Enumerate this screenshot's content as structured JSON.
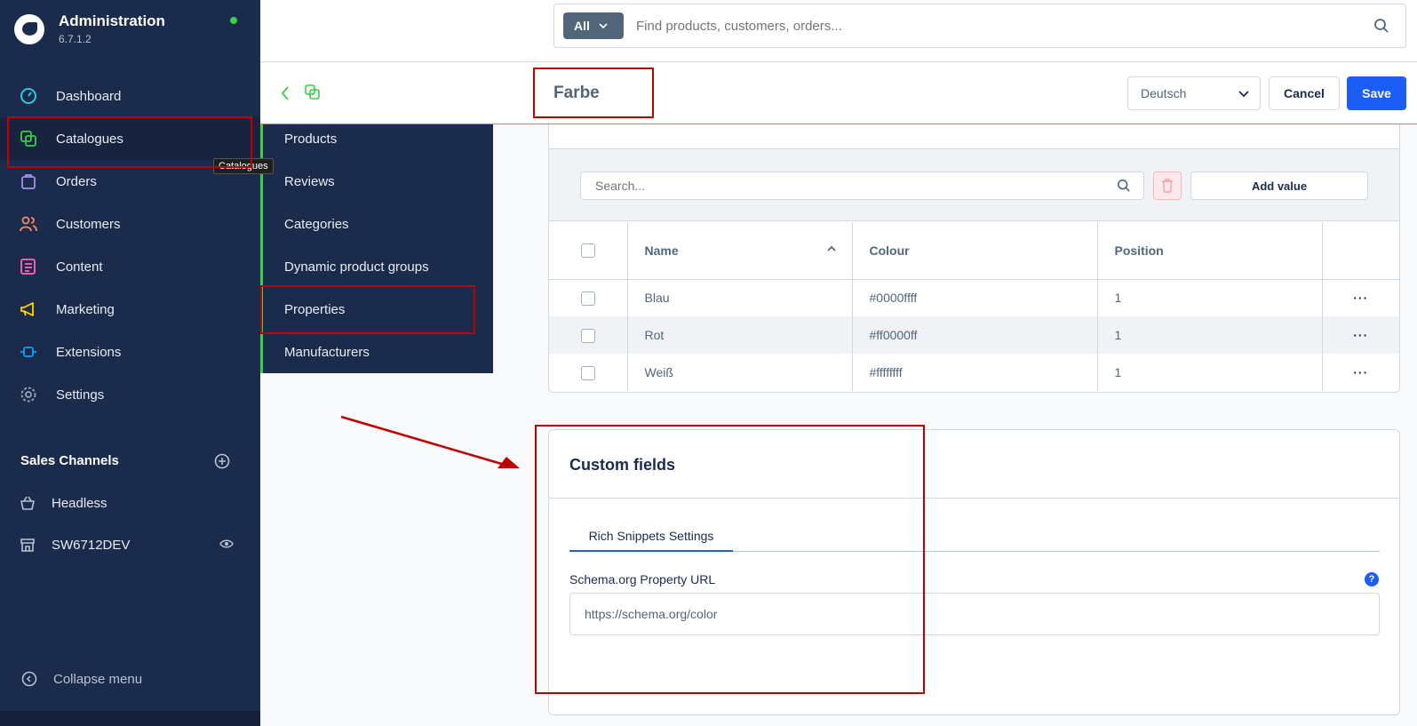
{
  "app": {
    "title": "Administration",
    "version": "6.7.1.2",
    "status_color": "#37d046",
    "brand_color": "#1b2b4b",
    "accent_color": "#1c5ef5"
  },
  "sidebar": {
    "items": [
      {
        "label": "Dashboard",
        "icon": "gauge-icon",
        "color": "#28d8f2"
      },
      {
        "label": "Catalogues",
        "icon": "copy-icon",
        "color": "#37d046"
      },
      {
        "label": "Orders",
        "icon": "bag-icon",
        "color": "#a092f0"
      },
      {
        "label": "Customers",
        "icon": "users-icon",
        "color": "#f88962"
      },
      {
        "label": "Content",
        "icon": "content-icon",
        "color": "#ff68b4"
      },
      {
        "label": "Marketing",
        "icon": "megaphone-icon",
        "color": "#ffd700"
      },
      {
        "label": "Extensions",
        "icon": "plug-icon",
        "color": "#189eff"
      },
      {
        "label": "Settings",
        "icon": "gear-icon",
        "color": "#9aa8b5"
      }
    ],
    "tooltip": "Catalogues",
    "sales_channels_title": "Sales Channels",
    "sales_channels": [
      {
        "label": "Headless",
        "icon": "basket-icon"
      },
      {
        "label": "SW6712DEV",
        "icon": "storefront-icon"
      }
    ],
    "collapse_label": "Collapse menu"
  },
  "flyout": {
    "items": [
      "Products",
      "Reviews",
      "Categories",
      "Dynamic product groups",
      "Properties",
      "Manufacturers"
    ]
  },
  "search": {
    "scope": "All",
    "placeholder": "Find products, customers, orders..."
  },
  "header": {
    "title": "Farbe",
    "language": "Deutsch",
    "cancel_label": "Cancel",
    "save_label": "Save"
  },
  "values": {
    "search_placeholder": "Search...",
    "add_label": "Add value",
    "columns": [
      "Name",
      "Colour",
      "Position"
    ],
    "rows": [
      {
        "name": "Blau",
        "colour": "#0000ffff",
        "position": "1"
      },
      {
        "name": "Rot",
        "colour": "#ff0000ff",
        "position": "1"
      },
      {
        "name": "Weiß",
        "colour": "#ffffffff",
        "position": "1"
      }
    ]
  },
  "custom_fields": {
    "title": "Custom fields",
    "tab": "Rich Snippets Settings",
    "field_label": "Schema.org Property URL",
    "field_value": "https://schema.org/color",
    "help": "?"
  }
}
